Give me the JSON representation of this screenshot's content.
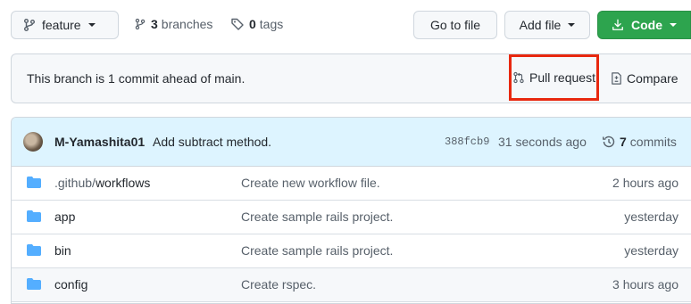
{
  "branch": {
    "current": "feature"
  },
  "meta": {
    "branches_count": "3",
    "branches_label": "branches",
    "tags_count": "0",
    "tags_label": "tags"
  },
  "actions": {
    "goto_file": "Go to file",
    "add_file": "Add file",
    "code": "Code"
  },
  "ahead": {
    "message": "This branch is 1 commit ahead of main.",
    "pull_request": "Pull request",
    "compare": "Compare"
  },
  "latest_commit": {
    "author": "M-Yamashita01",
    "message": "Add subtract method.",
    "sha": "388fcb9",
    "time": "31 seconds ago",
    "count": "7",
    "count_label": "commits"
  },
  "files": [
    {
      "dir_prefix": ".github/",
      "name": "workflows",
      "message": "Create new workflow file.",
      "age": "2 hours ago"
    },
    {
      "dir_prefix": "",
      "name": "app",
      "message": "Create sample rails project.",
      "age": "yesterday"
    },
    {
      "dir_prefix": "",
      "name": "bin",
      "message": "Create sample rails project.",
      "age": "yesterday"
    },
    {
      "dir_prefix": "",
      "name": "config",
      "message": "Create rspec.",
      "age": "3 hours ago"
    }
  ],
  "colors": {
    "accent_green": "#2da44e",
    "highlight_red": "#e8280f",
    "folder_blue": "#54aeff",
    "commit_bar": "#ddf4ff"
  }
}
